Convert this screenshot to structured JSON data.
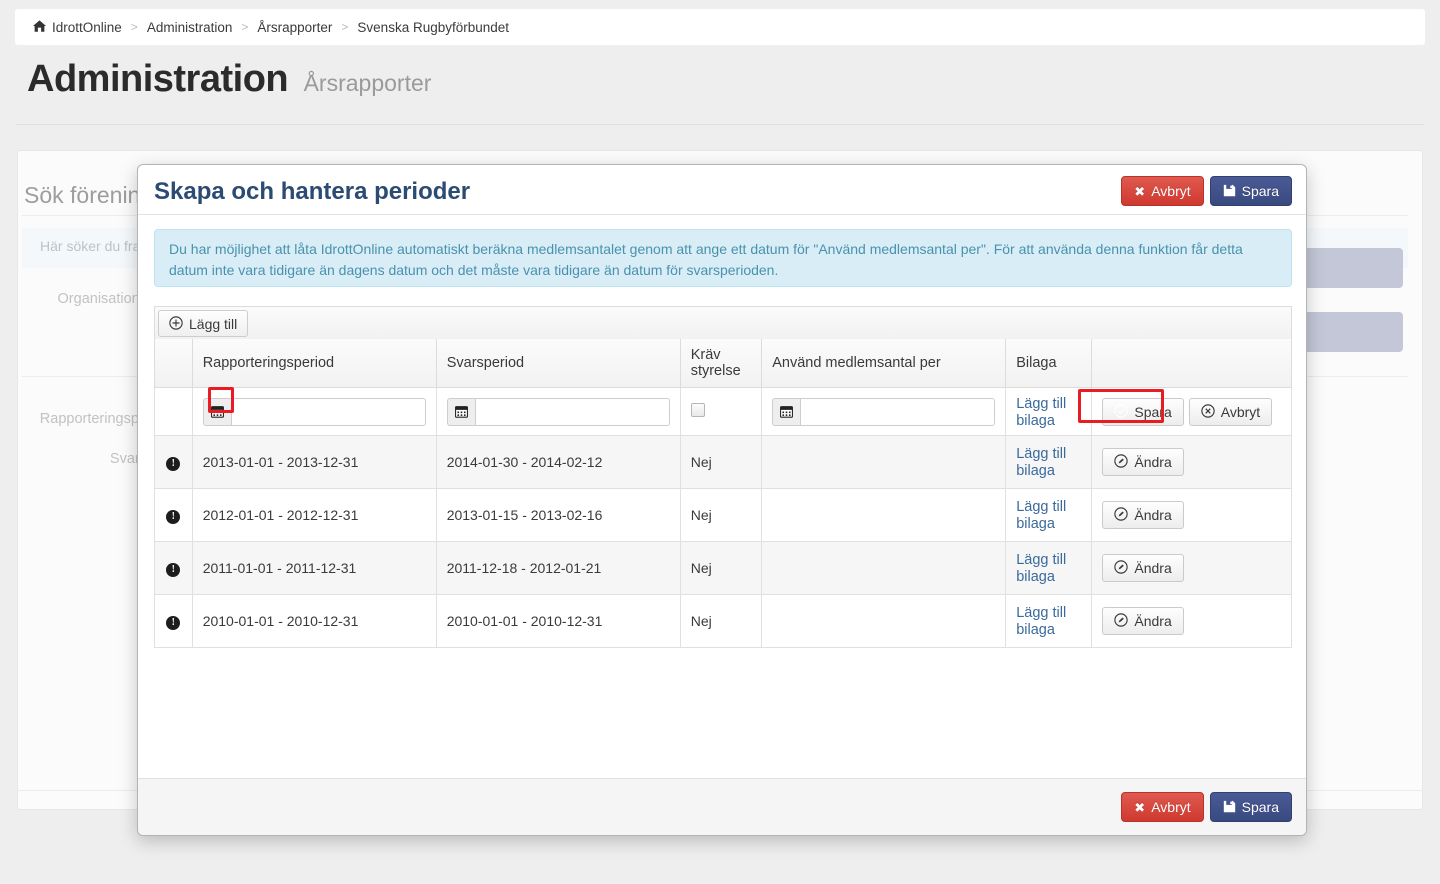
{
  "breadcrumb": {
    "home_icon": "home-icon",
    "items": [
      "IdrottOnline",
      "Administration",
      "Årsrapporter",
      "Svenska Rugbyförbundet"
    ],
    "separator": ">"
  },
  "page": {
    "title": "Administration",
    "subtitle": "Årsrapporter"
  },
  "background": {
    "panel_title": "Sök förening",
    "note": "Här söker du fra",
    "label_org": "Organisations",
    "label_rapport": "Rapporteringspe",
    "label_svar": "Svars"
  },
  "modal": {
    "title": "Skapa och hantera perioder",
    "alert": "Du har möjlighet att låta IdrottOnline automatiskt beräkna medlemsantalet genom att ange ett datum för \"Använd medlemsantal per\". För att använda denna funktion får detta datum inte vara tidigare än dagens datum och det måste vara tidigare än datum för svarsperioden.",
    "header_cancel": "Avbryt",
    "header_save": "Spara",
    "footer_cancel": "Avbryt",
    "footer_save": "Spara",
    "add_button": "Lägg till",
    "icons": {
      "cancel": "times-icon",
      "save": "floppy-disk-icon",
      "add": "plus-circle-icon",
      "calendar": "calendar-icon",
      "check_circle": "check-circle-icon",
      "times_circle": "times-circle-icon",
      "pencil_circle": "pencil-circle-icon",
      "info": "info-circle-icon"
    },
    "colors": {
      "danger": "#cf392f",
      "navy": "#394a80",
      "alert_bg": "#d9edf7",
      "alert_text": "#4992ad",
      "title": "#2c4b73",
      "highlight": "#e81d23",
      "link": "#3a6a9b"
    }
  },
  "table": {
    "headers": [
      "",
      "Rapporteringsperiod",
      "Svarsperiod",
      "Kräv styrelse",
      "Använd medlemsantal per",
      "Bilaga",
      ""
    ],
    "new_row": {
      "rapporteringsperiod_value": "",
      "svarsperiod_value": "",
      "krav_styrelse_checked": false,
      "anvand_medlemsantal_value": "",
      "bilaga_link": "Lägg till bilaga",
      "save_label": "Spara",
      "cancel_label": "Avbryt"
    },
    "rows": [
      {
        "rapporteringsperiod": "2013-01-01 - 2013-12-31",
        "svarsperiod": "2014-01-30 - 2014-02-12",
        "krav_styrelse": "Nej",
        "anvand_medlemsantal": "",
        "bilaga": "Lägg till bilaga",
        "action": "Ändra"
      },
      {
        "rapporteringsperiod": "2012-01-01 - 2012-12-31",
        "svarsperiod": "2013-01-15 - 2013-02-16",
        "krav_styrelse": "Nej",
        "anvand_medlemsantal": "",
        "bilaga": "Lägg till bilaga",
        "action": "Ändra"
      },
      {
        "rapporteringsperiod": "2011-01-01 - 2011-12-31",
        "svarsperiod": "2011-12-18 - 2012-01-21",
        "krav_styrelse": "Nej",
        "anvand_medlemsantal": "",
        "bilaga": "Lägg till bilaga",
        "action": "Ändra"
      },
      {
        "rapporteringsperiod": "2010-01-01 - 2010-12-31",
        "svarsperiod": "2010-01-01 - 2010-12-31",
        "krav_styrelse": "Nej",
        "anvand_medlemsantal": "",
        "bilaga": "Lägg till bilaga",
        "action": "Ändra"
      }
    ]
  }
}
